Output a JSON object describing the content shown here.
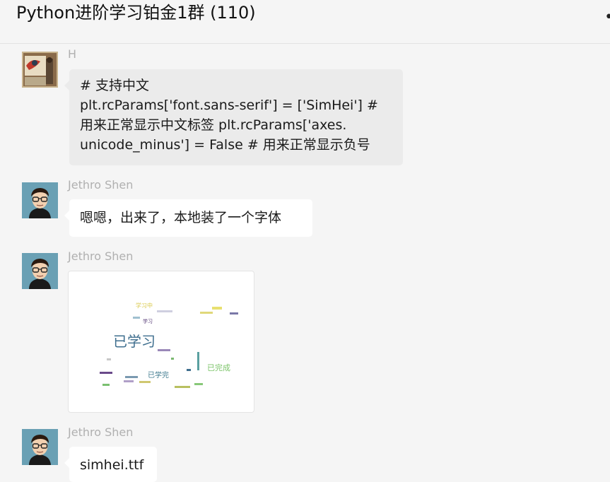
{
  "chat": {
    "title": "Python进阶学习铂金1群 (110)",
    "more_icon": "ellipsis-icon"
  },
  "messages": [
    {
      "sender": "H",
      "avatar": "painting-avatar",
      "lines": [
        "# 支持中文",
        "plt.rcParams['font.sans-serif'] = ['SimHei'] #",
        "用来正常显示中文标签 plt.rcParams['axes.",
        "unicode_minus'] = False # 用来正常显示负号"
      ]
    },
    {
      "sender": "Jethro Shen",
      "avatar": "cartoon-glasses-avatar",
      "text": "嗯嗯，出来了，本地装了一个字体"
    },
    {
      "sender": "Jethro Shen",
      "avatar": "cartoon-glasses-avatar",
      "image": "wordcloud-image",
      "wordcloud_words": [
        "已学习",
        "学习中",
        "已完成",
        "已学完",
        "学习"
      ]
    },
    {
      "sender": "Jethro Shen",
      "avatar": "cartoon-glasses-avatar",
      "text": "simhei.ttf"
    }
  ],
  "colors": {
    "background": "#f5f5f5",
    "bubble_grey": "#ebebeb",
    "bubble_white": "#ffffff",
    "sender_name": "#b0b0b0"
  }
}
